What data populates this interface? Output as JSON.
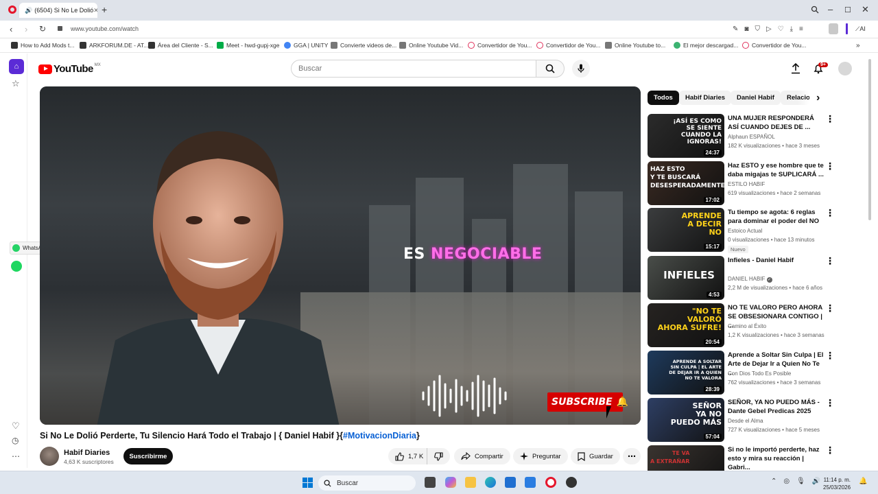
{
  "browser": {
    "tab_title": "(6504) Si No Le Dolió",
    "url": "www.youtube.com/watch",
    "ai_label": "AI",
    "bookmarks": [
      "How to Add Mods t...",
      "ARKFORUM.DE - AT...",
      "Área del Cliente - S...",
      "Meet - hwd-gupj-xge",
      "GGA | UNiTY",
      "Convierte videos de...",
      "Online Youtube Vid...",
      "Convertidor de You...",
      "Convertidor de You...",
      "Online Youtube to...",
      "El mejor descargad...",
      "Convertidor de You..."
    ]
  },
  "sidebar": {
    "whatsapp_tooltip": "WhatsApp"
  },
  "youtube": {
    "logo": "YouTube",
    "country": "MX",
    "search_placeholder": "Buscar",
    "notif_count": "9+"
  },
  "video": {
    "caption_plain": "ES",
    "caption_highlight": "NEGOCIABLE",
    "subscribe_overlay": "SUBSCRIBE",
    "title": "Si No Le Dolió Perderte, Tu Silencio Hará Todo el Trabajo | { Daniel Habif }{",
    "hashtag": "#MotivacionDiaria",
    "title_end": "}",
    "channel": "Habif Diaries",
    "subscribers": "4,63 K suscriptores",
    "subscribe_label": "Suscribirme",
    "likes": "1,7 K",
    "share_label": "Compartir",
    "ask_label": "Preguntar",
    "save_label": "Guardar"
  },
  "chips": [
    "Todos",
    "Habif Diaries",
    "Daniel Habif",
    "Relacio"
  ],
  "recommendations": [
    {
      "title": "UNA MUJER RESPONDERÁ ASÍ CUANDO DEJES DE ...",
      "channel": "Alphaun ESPAÑOL",
      "views": "182 K visualizaciones",
      "age": "hace 3 meses",
      "duration": "24:37",
      "thumb_text": "¡ASÍ ES COMO\nSE SIENTE\nCUANDO LA\nIGNORAS!",
      "thumb_color": "#2b2b2b",
      "verified": false,
      "new": ""
    },
    {
      "title": "Haz ESTO y ese hombre que te daba migajas te SUPLICARÁ ...",
      "channel": "ESTILO HABIF",
      "views": "619 visualizaciones",
      "age": "hace 2 semanas",
      "duration": "17:02",
      "thumb_text": "HAZ ESTO\nY TE BUSCARÁ\nDESESPERADAMENTE...",
      "thumb_color": "#3a2a22",
      "verified": false,
      "new": ""
    },
    {
      "title": "Tu tiempo se agota: 6 reglas para dominar el poder del NO",
      "channel": "Estoico Actual",
      "views": "0 visualizaciones",
      "age": "hace 13 minutos",
      "duration": "15:17",
      "thumb_text": "APRENDE\nA DECIR\nNO",
      "thumb_color": "#3b3d3e",
      "verified": false,
      "new": "Nuevo"
    },
    {
      "title": "Infieles - Daniel Habif",
      "channel": "DANIEL HABIF",
      "views": "2,2 M de visualizaciones",
      "age": "hace 6 años",
      "duration": "4:53",
      "thumb_text": "INFIELES",
      "thumb_color": "#4a4e4a",
      "verified": true,
      "new": ""
    },
    {
      "title": " NO TE VALORO PERO AHORA SE OBSESIONARA CONTIGO | ...",
      "channel": "Camino al Éxito",
      "views": "1,2 K visualizaciones",
      "age": "hace 3 semanas",
      "duration": "20:54",
      "thumb_text": "\"NO TE\nVALORÓ\nAHORA SUFRE!",
      "thumb_color": "#262321",
      "verified": false,
      "new": ""
    },
    {
      "title": "Aprende a Soltar Sin Culpa | El Arte de Dejar Ir a Quien No Te ...",
      "channel": "Con Dios Todo Es Posible",
      "views": "762 visualizaciones",
      "age": "hace 3 semanas",
      "duration": "28:39",
      "thumb_text": "APRENDE A SOLTAR\nSIN CULPA | EL ARTE\nDE DEJAR IR A QUIEN\nNO TE VALORA",
      "thumb_color": "#1e3a5c",
      "verified": false,
      "new": ""
    },
    {
      "title": "SEÑOR, YA NO PUEDO MÁS - Dante Gebel Predicas 2025",
      "channel": "Desde el Alma",
      "views": "727 K visualizaciones",
      "age": "hace 5 meses",
      "duration": "57:04",
      "thumb_text": "SEÑOR\nYA NO\nPUEDO MÁS",
      "thumb_color": "#2e3f64",
      "verified": false,
      "new": ""
    },
    {
      "title": "Si no le importó perderte, haz esto y mira su reacción | Gabri...",
      "channel": "",
      "views": "",
      "age": "",
      "duration": "",
      "thumb_text": "TE VA\nA EXTRAÑAR",
      "thumb_color": "#3a3430",
      "verified": false,
      "new": ""
    }
  ],
  "taskbar": {
    "search_label": "Buscar",
    "time": "11:14 p. m.",
    "date": "25/03/2026"
  }
}
